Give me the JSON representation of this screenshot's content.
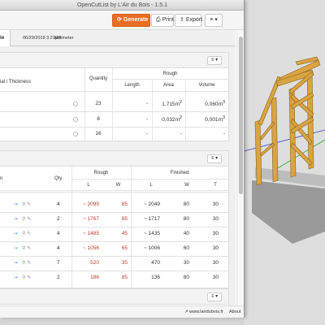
{
  "window": {
    "title": "OpenCutList by L'Air du Bois - 1.5.1"
  },
  "toolbar": {
    "generate_label": "Generate",
    "print_label": "Print",
    "export_label": "Export",
    "menu_label": "≡ ▾"
  },
  "tabbar": {
    "active_tab": "Sale",
    "date": "06/29/2018 3:21pm",
    "unit": "Millimeter"
  },
  "materials": {
    "col_name": "ial / Thickness",
    "col_quantity": "Quantity",
    "col_rough": "Rough",
    "col_length": "Length",
    "col_area": "Area",
    "col_volume": "Volume",
    "rows": [
      {
        "quantity": "23",
        "length": "-",
        "area": "1,715",
        "volume": "0,060"
      },
      {
        "quantity": "8",
        "length": "-",
        "area": "0,032",
        "volume": "0,001"
      },
      {
        "quantity": "16",
        "length": "-",
        "area": "-",
        "volume": "-"
      }
    ],
    "area_unit": "m",
    "area_exp": "2",
    "volume_unit": "m",
    "volume_exp": "3"
  },
  "parts": {
    "col_name": "n",
    "col_qty": "Qty",
    "col_rough": "Rough",
    "col_finished": "Finished",
    "col_l": "L",
    "col_w": "W",
    "col_t": "T",
    "rows": [
      {
        "qty": "4",
        "rough_l": "~ 2099",
        "rough_w": "85",
        "fin_l": "~ 2049",
        "fin_w": "80",
        "fin_t": "30"
      },
      {
        "qty": "2",
        "rough_l": "~ 1767",
        "rough_w": "85",
        "fin_l": "~ 1717",
        "fin_w": "80",
        "fin_t": "30"
      },
      {
        "qty": "4",
        "rough_l": "~ 1485",
        "rough_w": "45",
        "fin_l": "~ 1435",
        "fin_w": "40",
        "fin_t": "30"
      },
      {
        "qty": "4",
        "rough_l": "~ 1056",
        "rough_w": "65",
        "fin_l": "~ 1006",
        "fin_w": "60",
        "fin_t": "30"
      },
      {
        "qty": "7",
        "rough_l": "520",
        "rough_w": "35",
        "fin_l": "470",
        "fin_w": "30",
        "fin_t": "30"
      },
      {
        "qty": "2",
        "rough_l": "186",
        "rough_w": "85",
        "fin_l": "136",
        "fin_w": "80",
        "fin_t": "30"
      }
    ]
  },
  "statusbar": {
    "website": "www.lairdubois.fr",
    "about": "About"
  },
  "colors": {
    "accent": "#ea6e23",
    "rough_value": "#c0392b",
    "wood": "#d9a441",
    "link_icon": "#5a8fd6"
  },
  "icons": [
    "refresh-icon",
    "printer-icon",
    "export-icon",
    "hamburger-menu-icon",
    "radio-circle-icon",
    "pin-icon",
    "search-icon",
    "pencil-icon",
    "external-link-icon"
  ]
}
